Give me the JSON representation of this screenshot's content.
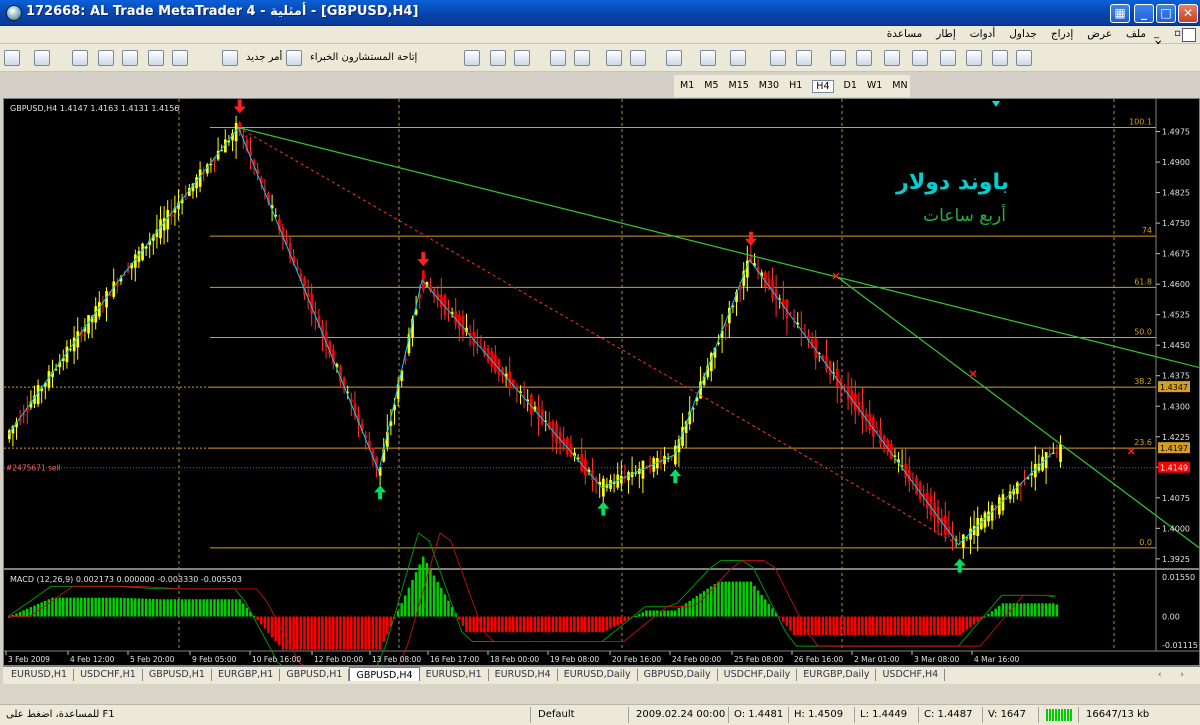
{
  "window": {
    "title": "172668: AL Trade MetaTrader 4 - أمثلية - [GBPUSD,H4]",
    "colors": {
      "titlebar": "#0a5fd8",
      "chart_bg": "#000000",
      "bull": "#ffff00",
      "bear": "#ff0000",
      "level": "#d4a020",
      "zigzag": "#00ccff",
      "trendline": "#32c832",
      "support": "#ff3030"
    }
  },
  "menu": {
    "items": [
      "ملف",
      "عرض",
      "إدراج",
      "جداول",
      "أدوات",
      "إطار",
      "مساعدة"
    ]
  },
  "toolbar": {
    "new_order": "أمر جديد",
    "expert_advisors": "إتاحة المستشارون الخبراء",
    "icons": [
      "new-chart-icon",
      "profiles-icon",
      "market-watch-icon",
      "navigator-icon",
      "terminal-icon",
      "tester-icon",
      "new-order-icon",
      "experts-icon",
      "bar-chart-icon",
      "candles-icon",
      "line-chart-icon",
      "zoom-in-icon",
      "zoom-out-icon",
      "tile-icon",
      "autoscroll-icon",
      "chart-shift-icon",
      "indicators-icon",
      "periods-icon",
      "templates-icon",
      "cursor-icon",
      "crosshair-icon",
      "vertical-line-icon",
      "horizontal-line-icon",
      "trend-line-icon",
      "fibo-icon",
      "channel-icon",
      "text-icon",
      "label-icon",
      "arrows-icon"
    ]
  },
  "timeframes": {
    "items": [
      "M1",
      "M5",
      "M15",
      "M30",
      "H1",
      "H4",
      "D1",
      "W1",
      "MN"
    ],
    "active": "H4"
  },
  "chart": {
    "header": "GBPUSD,H4  1.4147 1.4163 1.4131 1.4156",
    "overlay_title": "باوند دولار",
    "overlay_subtitle": "أربع ساعات",
    "order_label": "#2475671 sell",
    "fib_labels": [
      "100.1",
      "74",
      "61.8",
      "50.0",
      "38.2",
      "23.6",
      "0.0"
    ],
    "price_ticks": [
      "1.4975",
      "1.4900",
      "1.4825",
      "1.4750",
      "1.4675",
      "1.4600",
      "1.4525",
      "1.4450",
      "1.4375",
      "1.4300",
      "1.4225",
      "1.4150",
      "1.4075",
      "1.4000",
      "1.3925"
    ],
    "price_labels": [
      {
        "text": "1.4347",
        "price": 1.4347,
        "color": "#d4a020"
      },
      {
        "text": "1.4197",
        "price": 1.4197,
        "color": "#d4a020"
      },
      {
        "text": "1.4149",
        "price": 1.4149,
        "color": "#ff0000"
      }
    ],
    "macd_header": "MACD (12,26,9) 0.002173 0.000000 -0.003330 -0.005503",
    "macd_ticks": [
      "0.01550",
      "0.00",
      "-0.01115"
    ],
    "time_ticks": [
      "3 Feb 2009",
      "4 Feb 12:00",
      "5 Feb 20:00",
      "9 Feb 05:00",
      "10 Feb 16:00",
      "12 Feb 00:00",
      "13 Feb 08:00",
      "16 Feb 17:00",
      "18 Feb 00:00",
      "19 Feb 08:00",
      "20 Feb 16:00",
      "24 Feb 00:00",
      "25 Feb 08:00",
      "26 Feb 16:00",
      "2 Mar 01:00",
      "3 Mar 08:00",
      "4 Mar 16:00"
    ]
  },
  "chart_data": {
    "type": "candlestick",
    "symbol": "GBPUSD",
    "timeframe": "H4",
    "ylim": [
      1.3905,
      1.5055
    ],
    "fib_levels": [
      {
        "label": "100.1",
        "price": 1.4985
      },
      {
        "label": "74",
        "price": 1.4718
      },
      {
        "label": "61.8",
        "price": 1.4592
      },
      {
        "label": "50.0",
        "price": 1.4469
      },
      {
        "label": "38.2",
        "price": 1.4347
      },
      {
        "label": "23.6",
        "price": 1.4197
      },
      {
        "label": "0.0",
        "price": 1.3952
      }
    ],
    "order_line": {
      "label": "#2475671 sell",
      "price": 1.4149
    },
    "zigzag": [
      [
        0,
        1.423
      ],
      [
        30,
        1.46
      ],
      [
        64,
        1.4985
      ],
      [
        103,
        1.414
      ],
      [
        115,
        1.461
      ],
      [
        165,
        1.41
      ],
      [
        185,
        1.418
      ],
      [
        206,
        1.466
      ],
      [
        264,
        1.396
      ],
      [
        290,
        1.4185
      ]
    ],
    "up_arrows": [
      103,
      165,
      185,
      264
    ],
    "down_arrows": [
      64,
      115,
      206
    ],
    "cross_markers": [
      [
        230,
        1.462
      ],
      [
        268,
        1.438
      ],
      [
        312,
        1.419
      ]
    ],
    "trendlines": [
      {
        "from": [
          64,
          1.4985
        ],
        "to": [
          374,
          1.43
        ]
      },
      {
        "from": [
          230,
          1.462
        ],
        "to": [
          335,
          1.3925
        ]
      }
    ],
    "support_line": {
      "from": [
        64,
        1.4985
      ],
      "to": [
        264,
        1.396
      ]
    },
    "bars_visible": 315,
    "macd_range": [
      -0.01115,
      0.0155
    ]
  },
  "tabs": {
    "items": [
      "EURUSD,H1",
      "USDCHF,H1",
      "GBPUSD,H1",
      "EURGBP,H1",
      "GBPUSD,H1",
      "GBPUSD,H4",
      "EURUSD,H1",
      "EURUSD,H4",
      "EURUSD,Daily",
      "GBPUSD,Daily",
      "USDCHF,Daily",
      "EURGBP,Daily",
      "USDCHF,H4"
    ],
    "active_index": 5
  },
  "status": {
    "help": "للمساعدة، اضغط على F1",
    "profile": "Default",
    "datetime": "2009.02.24 00:00",
    "open": "O: 1.4481",
    "high": "H: 1.4509",
    "low": "L: 1.4449",
    "close": "C: 1.4487",
    "volume": "V: 1647",
    "traffic": "16647/13 kb"
  }
}
